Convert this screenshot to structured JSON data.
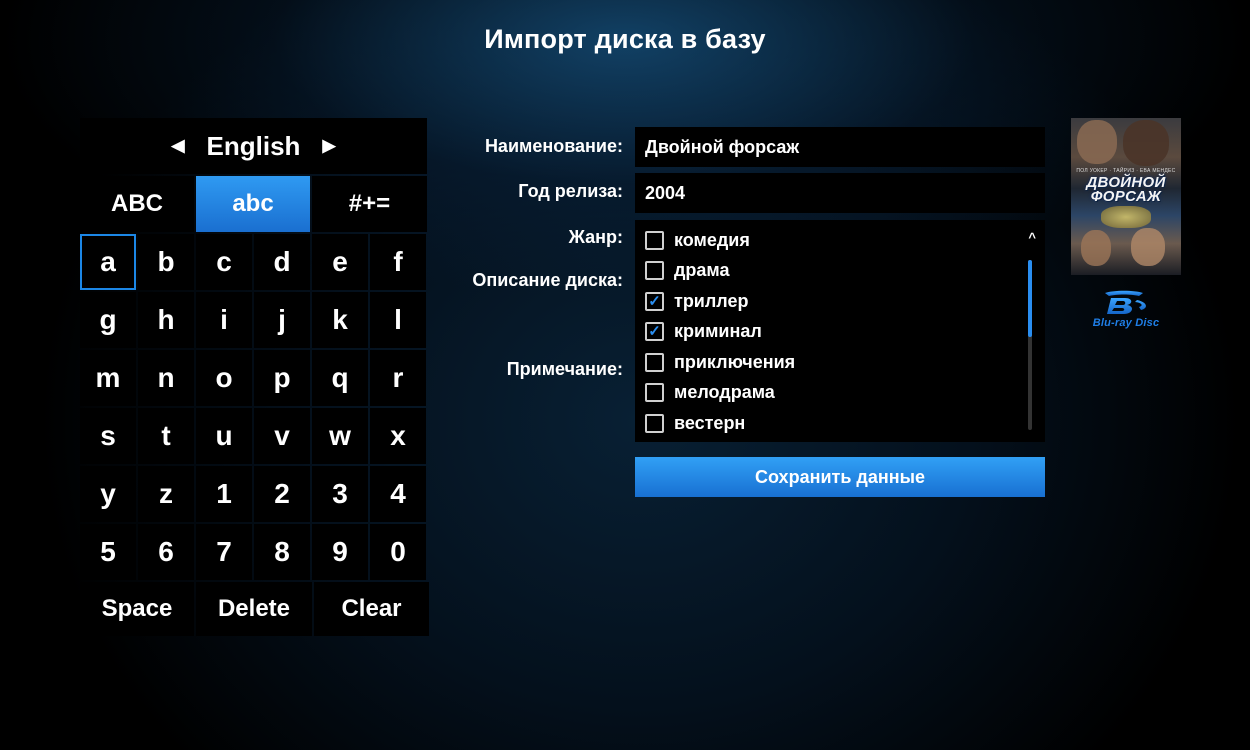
{
  "title": "Импорт диска в базу",
  "keyboard": {
    "language": "English",
    "modes": [
      "ABC",
      "abc",
      "#+="
    ],
    "active_mode": "abc",
    "focused_key": "a",
    "keys": [
      "a",
      "b",
      "c",
      "d",
      "e",
      "f",
      "g",
      "h",
      "i",
      "j",
      "k",
      "l",
      "m",
      "n",
      "o",
      "p",
      "q",
      "r",
      "s",
      "t",
      "u",
      "v",
      "w",
      "x",
      "y",
      "z",
      "1",
      "2",
      "3",
      "4",
      "5",
      "6",
      "7",
      "8",
      "9",
      "0"
    ],
    "actions": {
      "space": "Space",
      "delete": "Delete",
      "clear": "Clear"
    }
  },
  "form": {
    "name_label": "Наименование:",
    "name_value": "Двойной форсаж",
    "year_label": "Год релиза:",
    "year_value": "2004",
    "genre_label": "Жанр:",
    "description_label": "Описание диска:",
    "note_label": "Примечание:",
    "genres": [
      {
        "label": "комедия",
        "checked": false
      },
      {
        "label": "драма",
        "checked": false
      },
      {
        "label": "триллер",
        "checked": true
      },
      {
        "label": "криминал",
        "checked": true
      },
      {
        "label": "приключения",
        "checked": false
      },
      {
        "label": "мелодрама",
        "checked": false
      },
      {
        "label": "вестерн",
        "checked": false
      }
    ],
    "save_label": "Сохранить данные"
  },
  "poster": {
    "title": "ДВОЙНОЙ ФОРСАЖ",
    "cast_line": "ПОЛ УОКЕР · ТАЙРИЗ · ЕВА МЕНДЕС"
  },
  "disc_format": {
    "logo_text": "Blu-ray Disc",
    "icon": "blu-ray-disc-icon"
  },
  "colors": {
    "accent": "#2a8ef0",
    "panel": "#000000",
    "background": "#04101c"
  }
}
